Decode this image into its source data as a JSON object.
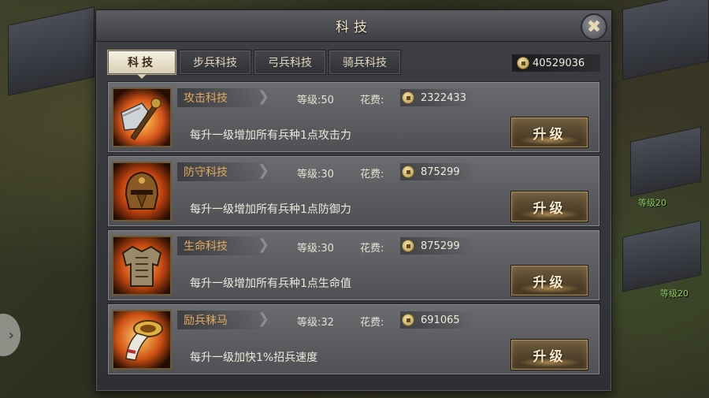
{
  "window": {
    "title": "科技",
    "close_icon": "crossed-swords-close-icon"
  },
  "tabs": [
    {
      "label": "科技",
      "active": true
    },
    {
      "label": "步兵科技",
      "active": false
    },
    {
      "label": "弓兵科技",
      "active": false
    },
    {
      "label": "骑兵科技",
      "active": false
    }
  ],
  "gold_total": "40529036",
  "common": {
    "level_prefix": "等级:",
    "cost_label": "花费:",
    "upgrade_label": "升级"
  },
  "techs": [
    {
      "name": "攻击科技",
      "level": "等级:50",
      "cost": "2322433",
      "desc": "每升一级增加所有兵种1点攻击力",
      "icon": "battle-axe-icon"
    },
    {
      "name": "防守科技",
      "level": "等级:30",
      "cost": "875299",
      "desc": "每升一级增加所有兵种1点防御力",
      "icon": "helmet-icon"
    },
    {
      "name": "生命科技",
      "level": "等级:30",
      "cost": "875299",
      "desc": "每升一级增加所有兵种1点生命值",
      "icon": "armor-icon"
    },
    {
      "name": "励兵秣马",
      "level": "等级:32",
      "cost": "691065",
      "desc": "每升一级加快1%招兵速度",
      "icon": "war-horn-icon"
    }
  ],
  "background": {
    "building_labels": [
      "等级20",
      "等级20"
    ]
  },
  "colors": {
    "accent_gold": "#e4a95a",
    "panel": "#3d3f44",
    "tab_active": "#f7f2e3"
  }
}
